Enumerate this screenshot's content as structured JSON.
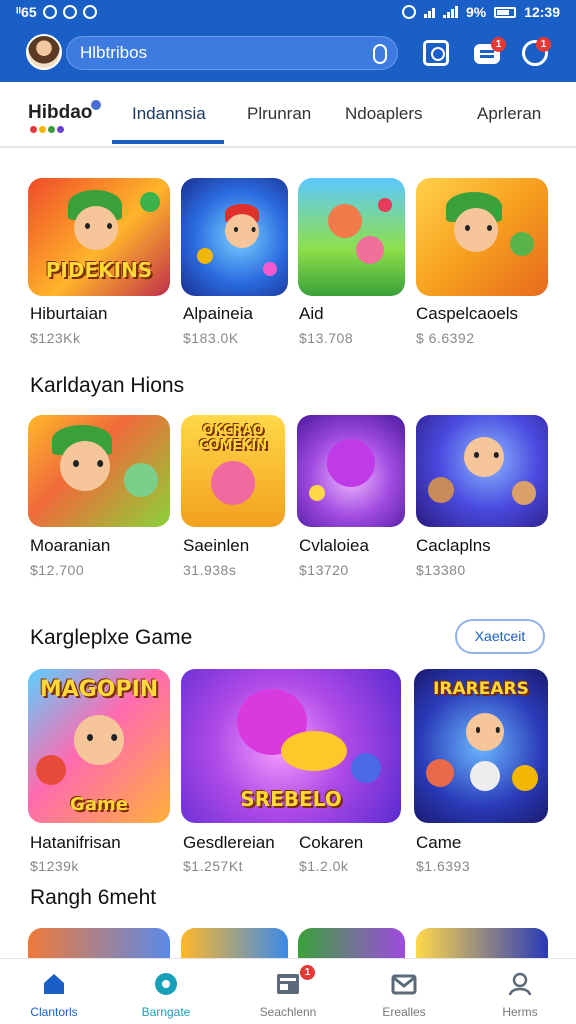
{
  "status": {
    "left_text": "ᴵᴵ65",
    "time": "12:39",
    "battery": "9%"
  },
  "header": {
    "search_text": "Hlbtribos"
  },
  "tabs": {
    "logo": "Hibdao",
    "items": [
      "Indannsia",
      "Plrunran",
      "Ndoaplers",
      "Aprleran"
    ],
    "active_index": 0
  },
  "badges": {
    "chat": "1",
    "notif": "1",
    "nav_search": "1"
  },
  "sections": [
    {
      "title": "",
      "cards": [
        {
          "name": "Hiburtaian",
          "price": "$123Kk",
          "art": "PIDEKINS"
        },
        {
          "name": "Alpaineia",
          "price": "$183.0K",
          "art": ""
        },
        {
          "name": "Aid",
          "price": "$13.708",
          "art": ""
        },
        {
          "name": "Caspelcaoels",
          "price": "$ 6.6392",
          "art": ""
        }
      ]
    },
    {
      "title": "Karldayan Hions",
      "cards": [
        {
          "name": "Moaranian",
          "price": "$12.700",
          "art": ""
        },
        {
          "name": "Saeinlen",
          "price": "31.938s",
          "art": "OKCRAO COMEKIN"
        },
        {
          "name": "Cvlaloiea",
          "price": "$13720",
          "art": ""
        },
        {
          "name": "Caclaplns",
          "price": "$13380",
          "art": ""
        }
      ]
    },
    {
      "title": "Kargleplxe Game",
      "more": "Xaetceit",
      "cards": [
        {
          "name": "Hatanifrisan",
          "price": "$1239k",
          "art": "MAGOPIN"
        },
        {
          "name": "Gesdlereian",
          "price": "$1.257Kt",
          "art": "SREBELO"
        },
        {
          "name": "Cokaren",
          "price": "$1.2.0k",
          "art": ""
        },
        {
          "name": "Came",
          "price": "$1.6393",
          "art": "IRAREARS"
        }
      ]
    },
    {
      "title": "Rangh 6meht"
    }
  ],
  "bottom_nav": [
    {
      "label": "Clantorls",
      "icon": "home-icon",
      "color": "#1a5fc6"
    },
    {
      "label": "Barngate",
      "icon": "gamepad-icon",
      "color": "#1aa0b8"
    },
    {
      "label": "Seachlenn",
      "icon": "news-icon",
      "color": "#777777"
    },
    {
      "label": "Erealles",
      "icon": "mail-icon",
      "color": "#777777"
    },
    {
      "label": "Herms",
      "icon": "profile-icon",
      "color": "#777777"
    }
  ],
  "colors": {
    "brand": "#1a5fc6",
    "accent": "#e53935"
  }
}
